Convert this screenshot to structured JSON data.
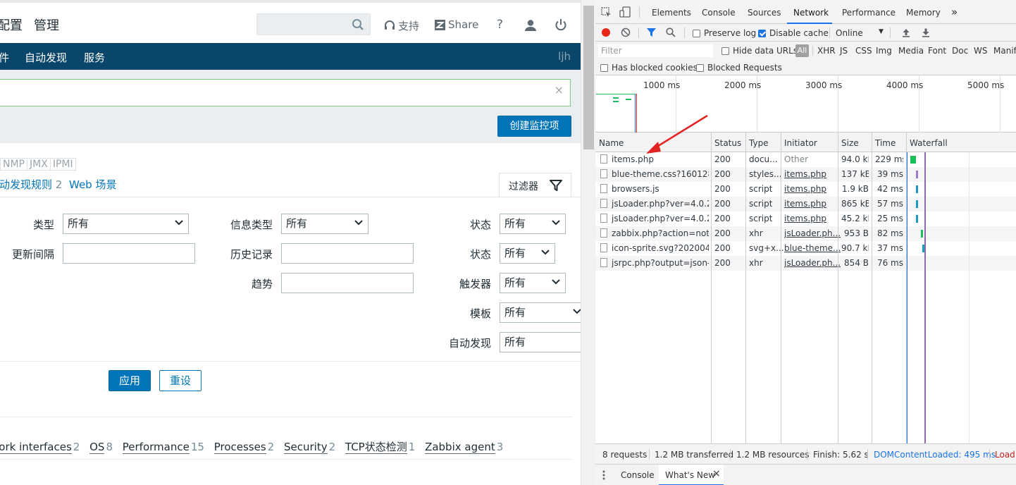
{
  "zabbix": {
    "top": {
      "tab_config": "配置",
      "tab_admin": "管理",
      "support": "支持",
      "share": "Share",
      "help": "?"
    },
    "nav": {
      "items": [
        "件",
        "自动发现",
        "服务"
      ],
      "user": "ljh"
    },
    "host_clear": "×",
    "create_button": "创建监控项",
    "protocols": [
      "NMP",
      "JMX",
      "IPMI"
    ],
    "tabs": [
      {
        "label": "动发现规则",
        "count": "2"
      },
      {
        "label": "Web 场景",
        "count": ""
      }
    ],
    "filter_tab": "过滤器",
    "filter": {
      "type_label": "类型",
      "type_value": "所有",
      "info_type_label": "信息类型",
      "info_type_value": "所有",
      "state_label": "状态",
      "state_value": "所有",
      "interval_label": "更新间隔",
      "history_label": "历史记录",
      "status_label": "状态",
      "status_value": "所有",
      "trends_label": "趋势",
      "triggers_label": "触发器",
      "triggers_value": "所有",
      "template_label": "模板",
      "template_value": "所有",
      "discovery_label": "自动发现",
      "discovery_value": "所有"
    },
    "apply": "应用",
    "reset": "重设",
    "applications": [
      {
        "name": "work interfaces",
        "count": "2"
      },
      {
        "name": "OS",
        "count": "8"
      },
      {
        "name": "Performance",
        "count": "15"
      },
      {
        "name": "Processes",
        "count": "2"
      },
      {
        "name": "Security",
        "count": "2"
      },
      {
        "name": "TCP状态检测",
        "count": "1"
      },
      {
        "name": "Zabbix agent",
        "count": "3"
      }
    ]
  },
  "devtools": {
    "tabs": [
      "Elements",
      "Console",
      "Sources",
      "Network",
      "Performance",
      "Memory",
      "»"
    ],
    "active_tab": "Network",
    "toolbar": {
      "preserve_log": "Preserve log",
      "disable_cache": "Disable cache",
      "throttle": "Online",
      "throttle_arrow": "▼"
    },
    "filter": {
      "placeholder": "Filter",
      "hide_data_urls": "Hide data URLs",
      "types": [
        "All",
        "XHR",
        "JS",
        "CSS",
        "Img",
        "Media",
        "Font",
        "Doc",
        "WS",
        "Manife"
      ]
    },
    "row2": {
      "blocked_cookies": "Has blocked cookies",
      "blocked_requests": "Blocked Requests"
    },
    "overview_ticks": [
      "1000 ms",
      "2000 ms",
      "3000 ms",
      "4000 ms",
      "5000 ms"
    ],
    "columns": [
      "Name",
      "Status",
      "Type",
      "Initiator",
      "Size",
      "Time",
      "Waterfall"
    ],
    "requests": [
      {
        "name": "items.php",
        "status": "200",
        "type": "docu...",
        "initiator": "Other",
        "size": "94.0 kB",
        "time": "229 ms",
        "wf_start_ms": 0,
        "wf_dur_ms": 229,
        "wf_color": "#1dbe5a"
      },
      {
        "name": "blue-theme.css?160128...",
        "status": "200",
        "type": "styles...",
        "initiator": "items.php",
        "size": "137 kB",
        "time": "39 ms",
        "wf_start_ms": 230,
        "wf_dur_ms": 39,
        "wf_color": "#9c76c9"
      },
      {
        "name": "browsers.js",
        "status": "200",
        "type": "script",
        "initiator": "items.php",
        "size": "1.9 kB",
        "time": "42 ms",
        "wf_start_ms": 230,
        "wf_dur_ms": 42,
        "wf_color": "#2196c8"
      },
      {
        "name": "jsLoader.php?ver=4.0.2...",
        "status": "200",
        "type": "script",
        "initiator": "items.php",
        "size": "865 kB",
        "time": "57 ms",
        "wf_start_ms": 230,
        "wf_dur_ms": 57,
        "wf_color": "#2196c8"
      },
      {
        "name": "jsLoader.php?ver=4.0.2...",
        "status": "200",
        "type": "script",
        "initiator": "items.php",
        "size": "45.2 kB",
        "time": "25 ms",
        "wf_start_ms": 230,
        "wf_dur_ms": 25,
        "wf_color": "#2196c8"
      },
      {
        "name": "zabbix.php?action=notif...",
        "status": "200",
        "type": "xhr",
        "initiator": "jsLoader.ph...",
        "size": "953 B",
        "time": "82 ms",
        "wf_start_ms": 430,
        "wf_dur_ms": 82,
        "wf_color": "#1dbe5a"
      },
      {
        "name": "icon-sprite.svg?20200407",
        "status": "200",
        "type": "svg+x...",
        "initiator": "blue-theme...",
        "size": "90.7 kB",
        "time": "37 ms",
        "wf_start_ms": 480,
        "wf_dur_ms": 37,
        "wf_color": "#17a2b8"
      },
      {
        "name": "jsrpc.php?output=json-...",
        "status": "200",
        "type": "xhr",
        "initiator": "jsLoader.ph...",
        "size": "854 B",
        "time": "76 ms",
        "wf_start_ms": 0,
        "wf_dur_ms": 0,
        "wf_color": "#1dbe5a"
      }
    ],
    "status_bar": {
      "requests": "8 requests",
      "transferred": "1.2 MB transferred",
      "resources": "1.2 MB resources",
      "finish": "Finish: 5.62 s",
      "dom": "DOMContentLoaded: 495 ms",
      "load": "Load:"
    },
    "drawer": {
      "console": "Console",
      "whats_new": "What's New",
      "close": "×"
    }
  }
}
